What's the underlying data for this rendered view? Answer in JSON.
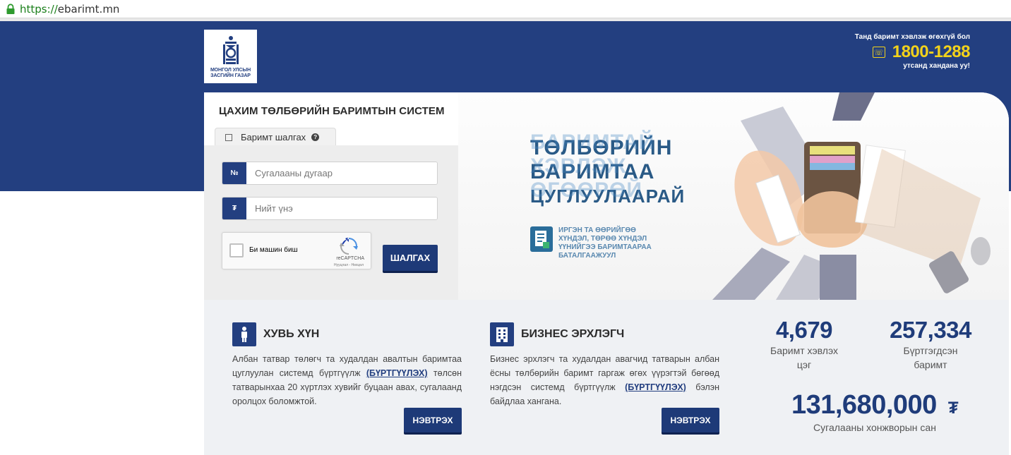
{
  "browser": {
    "url_protocol": "https://",
    "url_host": "ebarimt.mn"
  },
  "header": {
    "logo_line1": "МОНГОЛ УЛСЫН",
    "logo_line2": "ЗАСГИЙН ГАЗАР",
    "hotline_top": "Танд баримт хэвлэж өгөхгүй бол",
    "hotline_number": "1800-1288",
    "hotline_bottom": "утсанд хандана уу!"
  },
  "hero": {
    "system_title": "ЦАХИМ ТӨЛБӨРИЙН БАРИМТЫН СИСТЕМ",
    "tab_label": "Баримт шалгах",
    "lottery_placeholder": "Сугалааны дугаар",
    "lottery_prefix": "№",
    "amount_placeholder": "Нийт үнэ",
    "amount_prefix": "₮",
    "captcha_label": "Би машин биш",
    "captcha_brand": "reCAPTCHA",
    "captcha_links": "Нууцлал - Нөхцөл",
    "search_button": "ШАЛГАХ",
    "banner_line1": "ТӨЛБӨРИЙН",
    "banner_line2": "БАРИМТАА",
    "banner_line3": "ЦУГЛУУЛААРАЙ",
    "banner_ghost1": "БАРИМТАЙ",
    "banner_ghost2": "ХЭВЛЭЖ",
    "banner_ghost3": "ӨГӨӨРӨЙ",
    "banner_sub": "ИРГЭН ТА ӨӨРИЙГӨӨ ХҮНДЭЛ, ТӨРӨӨ ХҮНДЭЛ ҮҮНИЙГЭЭ БАРИМТААРАА БАТАЛГААЖУУЛ"
  },
  "personal": {
    "title": "ХУВЬ ХҮН",
    "text_before": "Албан татвар төлөгч та худалдан авалтын баримтаа цуглуулан системд бүртгүүлж",
    "link": "(БҮРТГҮҮЛЭХ)",
    "text_after": "төлсөн татварынхаа 20 хүртлэх хувийг буцаан авах, сугалаанд оролцох боломжтой.",
    "button": "НЭВТРЭХ"
  },
  "business": {
    "title": "БИЗНЕС ЭРХЛЭГЧ",
    "text_before": "Бизнес эрхлэгч та худалдан авагчид татварын албан ёсны төлбөрийн баримт гаргаж өгөх үүрэгтэй бөгөөд нэгдсэн системд бүртгүүлж",
    "link": "(БҮРТГҮҮЛЭХ)",
    "text_after": "бэлэн байдлаа хангана.",
    "button": "НЭВТРЭХ"
  },
  "stats": {
    "points_value": "4,679",
    "points_label": "Баримт хэвлэх цэг",
    "receipts_value": "257,334",
    "receipts_label_1": "Бүртгэгдсэн",
    "receipts_label_2": "баримт",
    "prize_value": "131,680,000",
    "prize_currency": "₮",
    "prize_label": "Сугалааны хонжворын сан"
  },
  "colors": {
    "brand_blue": "#233f80",
    "hotline_yellow": "#f2d21b",
    "lower_bg": "#eff1f4"
  }
}
